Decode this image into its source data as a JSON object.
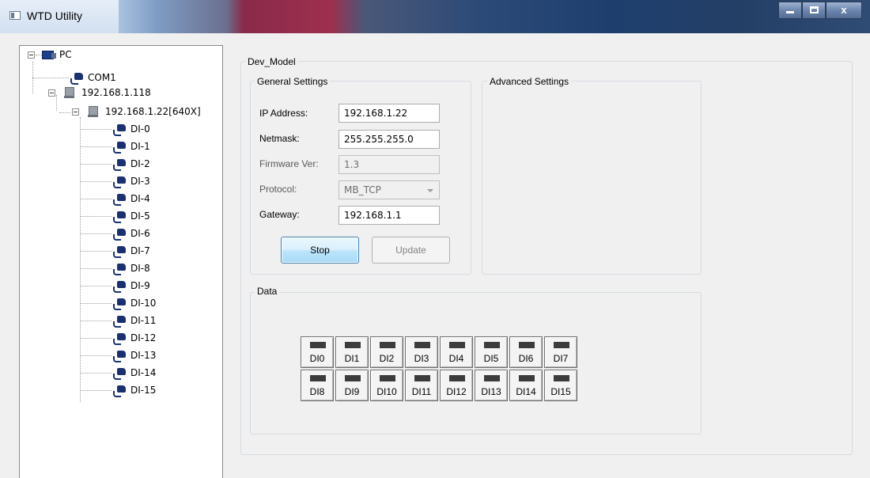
{
  "window": {
    "title": "WTD Utility",
    "buttons": {
      "minimize": "minimize",
      "maximize": "maximize",
      "close": "x"
    }
  },
  "tree": {
    "root": "PC",
    "com": "COM1",
    "host": "192.168.1.118",
    "device": "192.168.1.22[640X]",
    "channels": [
      "DI-0",
      "DI-1",
      "DI-2",
      "DI-3",
      "DI-4",
      "DI-5",
      "DI-6",
      "DI-7",
      "DI-8",
      "DI-9",
      "DI-10",
      "DI-11",
      "DI-12",
      "DI-13",
      "DI-14",
      "DI-15"
    ]
  },
  "main": {
    "group_title": "Dev_Model",
    "general": {
      "title": "General Settings",
      "ip_label": "IP Address:",
      "ip_value": "192.168.1.22",
      "netmask_label": "Netmask:",
      "netmask_value": "255.255.255.0",
      "firmware_label": "Firmware Ver:",
      "firmware_value": "1.3",
      "protocol_label": "Protocol:",
      "protocol_value": "MB_TCP",
      "gateway_label": "Gateway:",
      "gateway_value": "192.168.1.1",
      "stop_label": "Stop",
      "update_label": "Update"
    },
    "advanced": {
      "title": "Advanced Settings"
    },
    "data": {
      "title": "Data",
      "di": [
        "DI0",
        "DI1",
        "DI2",
        "DI3",
        "DI4",
        "DI5",
        "DI6",
        "DI7",
        "DI8",
        "DI9",
        "DI10",
        "DI11",
        "DI12",
        "DI13",
        "DI14",
        "DI15"
      ]
    }
  },
  "colors": {
    "led_off": "#3c3c3c",
    "button_blue": "#3c7fb1"
  }
}
